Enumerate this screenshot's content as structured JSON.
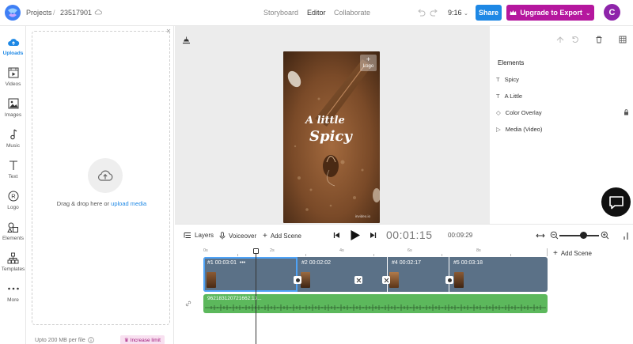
{
  "header": {
    "breadcrumb_root": "Projects",
    "breadcrumb_sep": "/",
    "project_id": "23517901",
    "tabs": [
      "Storyboard",
      "Editor",
      "Collaborate"
    ],
    "active_tab": "Editor",
    "aspect_ratio": "9:16",
    "share_label": "Share",
    "upgrade_label": "Upgrade to Export",
    "avatar_initial": "C"
  },
  "rail": {
    "items": [
      "Uploads",
      "Videos",
      "Images",
      "Music",
      "Text",
      "Logo",
      "Elements",
      "Templates",
      "More"
    ],
    "active": "Uploads"
  },
  "uploads": {
    "drop_text": "Drag & drop here or",
    "drop_link": "upload media",
    "limit_text": "Upto 200 MB per file",
    "increase_label": "Increase limit"
  },
  "preview": {
    "logo_label": "Logo",
    "title_line1": "A little",
    "title_line2": "Spicy",
    "watermark": "invideo.io"
  },
  "elements_panel": {
    "title": "Elements",
    "items": [
      {
        "label": "Spicy",
        "icon": "text-icon"
      },
      {
        "label": "A Little",
        "icon": "text-icon"
      },
      {
        "label": "Color Overlay",
        "icon": "diamond-icon",
        "locked": true
      },
      {
        "label": "Media (Video)",
        "icon": "play-icon"
      }
    ]
  },
  "timeline": {
    "layers_label": "Layers",
    "voiceover_label": "Voiceover",
    "add_scene_label": "Add Scene",
    "current_time": "00:01:15",
    "total_time": "00:09:29",
    "zoom_level": 0.6,
    "ruler": [
      "0s",
      "2s",
      "4s",
      "6s",
      "8s"
    ],
    "scenes": [
      {
        "label": "#1  00:03:01",
        "more": "•••"
      },
      {
        "label": "#2  00:02:02"
      },
      {
        "label": "#4  00:02:17"
      },
      {
        "label": "#5  00:03:18"
      }
    ],
    "audio_label": "962183120721662:13...",
    "add_scene_side": "Add Scene"
  },
  "colors": {
    "accent": "#1e88e5",
    "upgrade": "#b5179e",
    "avatar": "#8e24aa",
    "scene_track": "#5b7187",
    "audio_track": "#5cb85c"
  }
}
